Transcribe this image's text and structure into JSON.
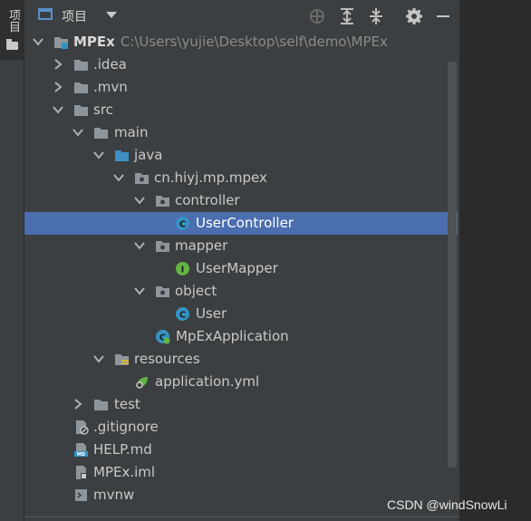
{
  "strip": {
    "tab_label": "项目"
  },
  "header": {
    "title": "项目"
  },
  "tree": {
    "root": {
      "name": "MPEx",
      "path": "C:\\Users\\yujie\\Desktop\\self\\demo\\MPEx"
    },
    "items": [
      {
        "label": "MPEx",
        "icon": "module-folder-icon",
        "expanded": true
      },
      {
        "label": ".idea",
        "icon": "folder-icon",
        "expanded": false
      },
      {
        "label": ".mvn",
        "icon": "folder-icon",
        "expanded": false
      },
      {
        "label": "src",
        "icon": "folder-icon",
        "expanded": true
      },
      {
        "label": "main",
        "icon": "folder-icon",
        "expanded": true
      },
      {
        "label": "java",
        "icon": "source-folder-icon",
        "expanded": true
      },
      {
        "label": "cn.hiyj.mp.mpex",
        "icon": "package-icon",
        "expanded": true
      },
      {
        "label": "controller",
        "icon": "package-icon",
        "expanded": true
      },
      {
        "label": "UserController",
        "icon": "class-icon",
        "selected": true
      },
      {
        "label": "mapper",
        "icon": "package-icon",
        "expanded": true
      },
      {
        "label": "UserMapper",
        "icon": "interface-icon"
      },
      {
        "label": "object",
        "icon": "package-icon",
        "expanded": true
      },
      {
        "label": "User",
        "icon": "class-icon"
      },
      {
        "label": "MpExApplication",
        "icon": "spring-boot-class-icon"
      },
      {
        "label": "resources",
        "icon": "resources-folder-icon",
        "expanded": true
      },
      {
        "label": "application.yml",
        "icon": "spring-yml-icon"
      },
      {
        "label": "test",
        "icon": "folder-icon",
        "expanded": false
      },
      {
        "label": ".gitignore",
        "icon": "gitignore-file-icon"
      },
      {
        "label": "HELP.md",
        "icon": "markdown-file-icon"
      },
      {
        "label": "MPEx.iml",
        "icon": "iml-file-icon"
      },
      {
        "label": "mvnw",
        "icon": "shell-file-icon"
      }
    ]
  },
  "watermark": "CSDN @windSnowLi",
  "colors": {
    "selection": "#4b6eaf",
    "panel": "#3c3f41",
    "background": "#2b2b2b"
  }
}
